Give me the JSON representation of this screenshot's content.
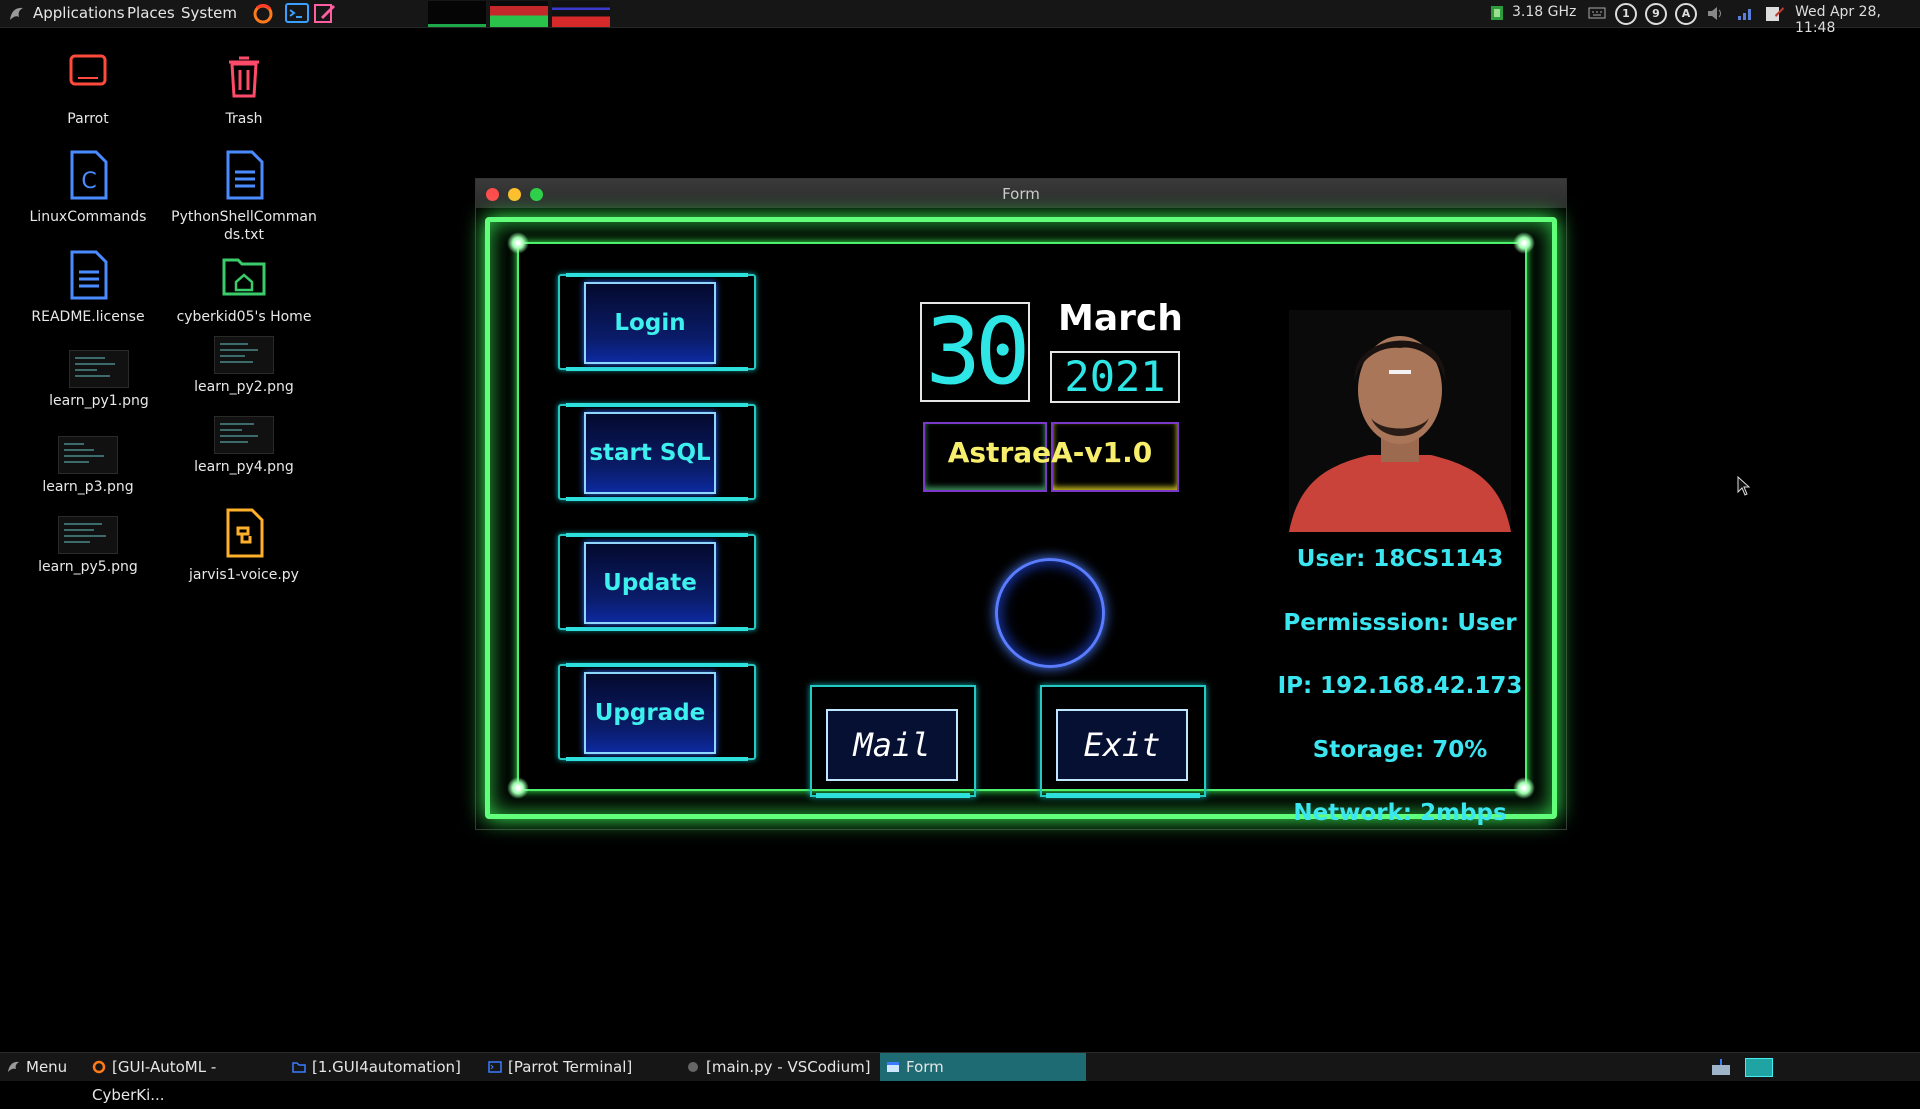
{
  "top_panel": {
    "menus": [
      "Applications",
      "Places",
      "System"
    ],
    "cpu_freq": "3.18 GHz",
    "tray_indicators": [
      "1",
      "9",
      "A"
    ],
    "clock": "Wed Apr 28, 11:48"
  },
  "desktop": {
    "icons": [
      {
        "label": "Parrot",
        "icon": "laptop-icon"
      },
      {
        "label": "Trash",
        "icon": "trash-icon"
      },
      {
        "label": "LinuxCommands",
        "icon": "c-file-icon"
      },
      {
        "label": "PythonShellCommands.txt",
        "icon": "text-file-icon"
      },
      {
        "label": "README.license",
        "icon": "text-file-icon"
      },
      {
        "label": "cyberkid05's Home",
        "icon": "home-folder-icon"
      },
      {
        "label": "learn_py1.png",
        "icon": "image-thumbnail"
      },
      {
        "label": "learn_py2.png",
        "icon": "image-thumbnail"
      },
      {
        "label": "learn_p3.png",
        "icon": "image-thumbnail"
      },
      {
        "label": "learn_py4.png",
        "icon": "image-thumbnail"
      },
      {
        "label": "learn_py5.png",
        "icon": "image-thumbnail"
      },
      {
        "label": "jarvis1-voice.py",
        "icon": "python-file-icon"
      }
    ]
  },
  "window": {
    "title": "Form",
    "buttons": {
      "login": "Login",
      "start_sql": "start SQL",
      "update": "Update",
      "upgrade": "Upgrade",
      "mail": "Mail",
      "exit": "Exit"
    },
    "date": {
      "day": "30",
      "month": "March",
      "year": "2021"
    },
    "brand": "AstraeA-v1.0",
    "info": {
      "user": "User: 18CS1143",
      "permission": "Permisssion: User",
      "ip": "IP: 192.168.42.173",
      "storage": "Storage: 70%",
      "network": "Network: 2mbps"
    }
  },
  "taskbar": {
    "menu": "Menu",
    "tasks": [
      {
        "label": "[GUI-AutoML - CyberKi...",
        "active": false
      },
      {
        "label": "[1.GUI4automation]",
        "active": false
      },
      {
        "label": "[Parrot Terminal]",
        "active": false
      },
      {
        "label": "[main.py - VSCodium]",
        "active": false
      },
      {
        "label": "Form",
        "active": true
      }
    ]
  },
  "colors": {
    "frame_green": "#62ff7a",
    "hud_cyan": "#2ee0db",
    "info_cyan": "#3be6f0",
    "brand_yellow": "#f7ef6c",
    "taskbar_active": "#1f6b73"
  }
}
